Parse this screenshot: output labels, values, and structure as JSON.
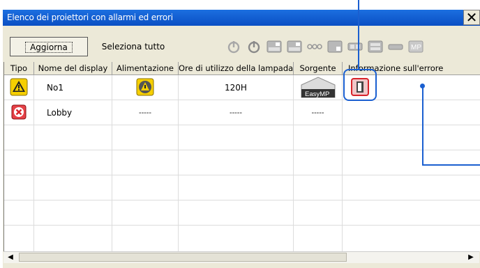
{
  "window": {
    "title": "Elenco dei proiettori con allarmi ed errori",
    "close_glyph": "✕"
  },
  "toolbar": {
    "refresh_label": "Aggiorna",
    "select_all_label": "Seleziona tutto",
    "icons": [
      "power-on-icon",
      "power-off-icon",
      "source-computer1-icon",
      "source-computer2-icon",
      "source-video-icon",
      "source-svideo-icon",
      "source-component-icon",
      "source-hdmi-icon",
      "source-lan-icon",
      "source-easymp-icon"
    ],
    "easymp_label": "MP"
  },
  "table": {
    "columns": [
      "Tipo",
      "Nome del display",
      "Alimentazione",
      "Ore di utilizzo della lampada",
      "Sorgente",
      "Informazione sull'errore"
    ],
    "rows": [
      {
        "type_icon": "warning-icon",
        "name": "No1",
        "power_icon": "lamp-warning-icon",
        "lamp_hours": "120H",
        "source_icon": "easymp-source-icon",
        "source_text": "EasyMP",
        "error_icon": "lamp-error-icon"
      },
      {
        "type_icon": "error-icon",
        "name": "Lobby",
        "power": "-----",
        "lamp_hours": "-----",
        "source": "-----",
        "error_icon": ""
      }
    ]
  },
  "colors": {
    "title_bar": "#0a4fc3",
    "callout": "#1a5fd0",
    "warning": "#f4c400",
    "error": "#d8232a"
  }
}
